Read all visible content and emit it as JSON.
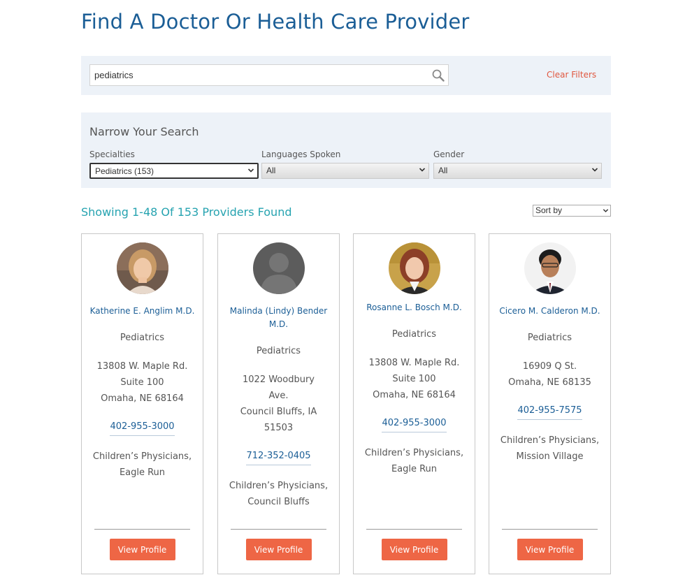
{
  "page": {
    "title": "Find A Doctor Or Health Care Provider"
  },
  "search": {
    "value": "pediatrics",
    "clear_filters": "Clear Filters"
  },
  "narrow": {
    "title": "Narrow Your Search",
    "filters": [
      {
        "label": "Specialties",
        "selected": "Pediatrics (153)"
      },
      {
        "label": "Languages Spoken",
        "selected": "All"
      },
      {
        "label": "Gender",
        "selected": "All"
      }
    ]
  },
  "results": {
    "heading": "Showing 1-48 Of 153 Providers Found",
    "sort_label": "Sort by"
  },
  "colors": {
    "brand_blue": "#1b5e96",
    "teal": "#26a3b0",
    "accent_orange": "#ee6645",
    "panel_bg": "#edf2f8"
  },
  "providers": [
    {
      "name": "Katherine E. Anglim M.D.",
      "specialty": "Pediatrics",
      "address": [
        "13808 W. Maple Rd.",
        "Suite 100",
        "Omaha, NE 68164"
      ],
      "phone": "402-955-3000",
      "location": [
        "Children’s Physicians,",
        "Eagle Run"
      ],
      "button": "View Profile"
    },
    {
      "name": "Malinda (Lindy) Bender M.D.",
      "specialty": "Pediatrics",
      "address": [
        "1022 Woodbury",
        "Ave.",
        "Council Bluffs, IA",
        "51503"
      ],
      "phone": "712-352-0405",
      "location": [
        "Children’s Physicians,",
        "Council Bluffs"
      ],
      "button": "View Profile"
    },
    {
      "name": "Rosanne L. Bosch M.D.",
      "specialty": "Pediatrics",
      "address": [
        "13808 W. Maple Rd.",
        "Suite 100",
        "Omaha, NE 68164"
      ],
      "phone": "402-955-3000",
      "location": [
        "Children’s Physicians,",
        "Eagle Run"
      ],
      "button": "View Profile"
    },
    {
      "name": "Cicero M. Calderon M.D.",
      "specialty": "Pediatrics",
      "address": [
        "16909 Q St.",
        "Omaha, NE 68135"
      ],
      "phone": "402-955-7575",
      "location": [
        "Children’s Physicians,",
        "Mission Village"
      ],
      "button": "View Profile"
    }
  ]
}
